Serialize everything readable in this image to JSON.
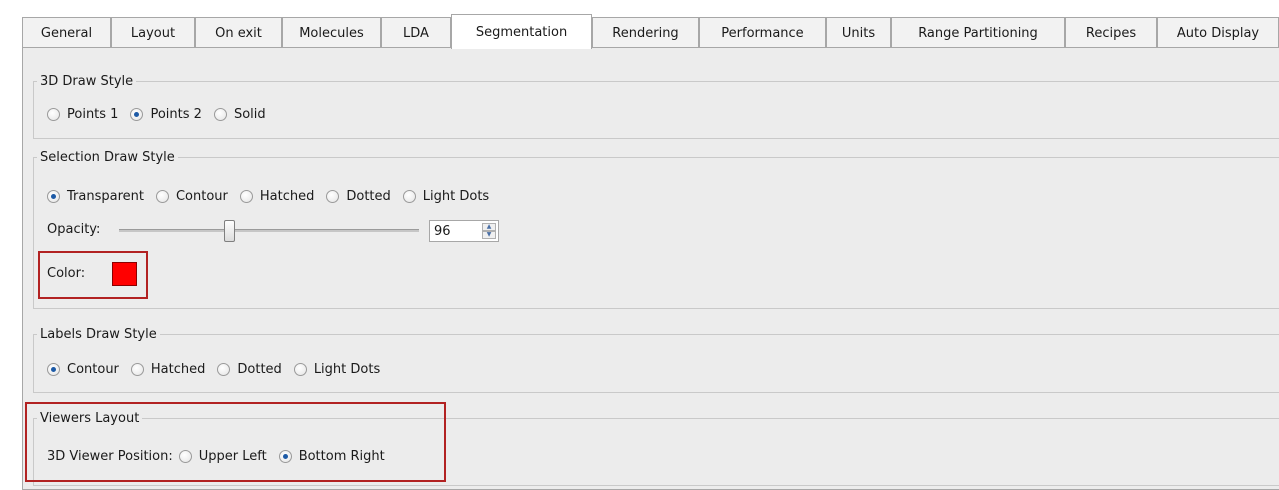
{
  "tabs": [
    {
      "label": "General"
    },
    {
      "label": "Layout"
    },
    {
      "label": "On exit"
    },
    {
      "label": "Molecules"
    },
    {
      "label": "LDA"
    },
    {
      "label": "Segmentation"
    },
    {
      "label": "Rendering"
    },
    {
      "label": "Performance"
    },
    {
      "label": "Units"
    },
    {
      "label": "Range Partitioning"
    },
    {
      "label": "Recipes"
    },
    {
      "label": "Auto Display"
    }
  ],
  "active_tab": "Segmentation",
  "draw3d": {
    "title": "3D Draw Style",
    "options": [
      {
        "label": "Points 1",
        "checked": false
      },
      {
        "label": "Points 2",
        "checked": true
      },
      {
        "label": "Solid",
        "checked": false
      }
    ]
  },
  "selection": {
    "title": "Selection Draw Style",
    "options": [
      {
        "label": "Transparent",
        "checked": true
      },
      {
        "label": "Contour",
        "checked": false
      },
      {
        "label": "Hatched",
        "checked": false
      },
      {
        "label": "Dotted",
        "checked": false
      },
      {
        "label": "Light Dots",
        "checked": false
      }
    ],
    "opacity_label": "Opacity:",
    "opacity_value": "96",
    "color_label": "Color:",
    "color_value": "#ff0000"
  },
  "labels": {
    "title": "Labels Draw Style",
    "options": [
      {
        "label": "Contour",
        "checked": true
      },
      {
        "label": "Hatched",
        "checked": false
      },
      {
        "label": "Dotted",
        "checked": false
      },
      {
        "label": "Light Dots",
        "checked": false
      }
    ]
  },
  "viewers": {
    "title": "Viewers Layout",
    "position_label": "3D Viewer Position:",
    "options": [
      {
        "label": "Upper Left",
        "checked": false
      },
      {
        "label": "Bottom Right",
        "checked": true
      }
    ]
  },
  "icons": {
    "spin_up": "spin-up-arrow-icon",
    "spin_down": "spin-down-arrow-icon"
  },
  "colors": {
    "highlight": "#b22222",
    "radio_dot": "#1d5aa6"
  }
}
